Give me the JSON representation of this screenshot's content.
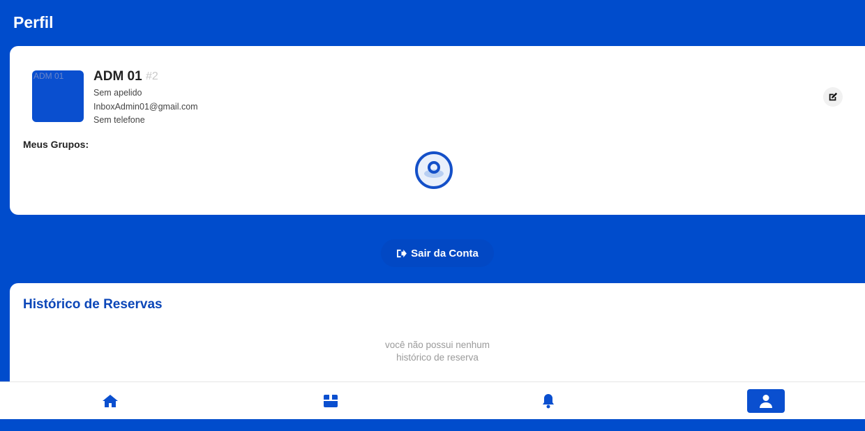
{
  "header": {
    "title": "Perfil"
  },
  "profile": {
    "avatar_alt": "ADM 01",
    "name": "ADM 01",
    "id_tag": "#2",
    "nickname": "Sem apelido",
    "email": "InboxAdmin01@gmail.com",
    "phone": "Sem telefone",
    "groups_label": "Meus Grupos:"
  },
  "actions": {
    "logout_label": "Sair da Conta"
  },
  "history": {
    "title": "Histórico de Reservas",
    "empty_line1": "você não possui nenhum",
    "empty_line2": "histórico de reserva"
  },
  "bottom_nav": {
    "items": [
      {
        "icon": "home-icon"
      },
      {
        "icon": "box-icon"
      },
      {
        "icon": "bell-icon"
      },
      {
        "icon": "user-icon",
        "active": true
      }
    ]
  },
  "colors": {
    "brand_blue": "#004ccc",
    "title_blue": "#0b46b8",
    "card_bg": "#ffffff"
  }
}
